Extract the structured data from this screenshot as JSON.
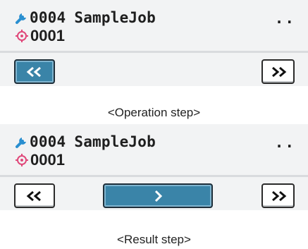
{
  "operation_panel": {
    "job_number": "0004",
    "job_name": "SampleJob",
    "step_number": "0001",
    "menu_dots": "..",
    "prev_button_label": "<<",
    "next_button_label": ">>"
  },
  "operation_caption": "<Operation step>",
  "result_panel": {
    "job_number": "0004",
    "job_name": "SampleJob",
    "step_number": "0001",
    "menu_dots": "..",
    "prev_button_label": "<<",
    "run_button_label": ">",
    "next_button_label": ">>"
  },
  "result_caption": "<Result step>",
  "colors": {
    "accent": "#3a84a8",
    "icon_wrench": "#2a8fd0",
    "icon_target": "#e0487a"
  },
  "icons": {
    "job": "wrench-icon",
    "step": "target-icon"
  }
}
